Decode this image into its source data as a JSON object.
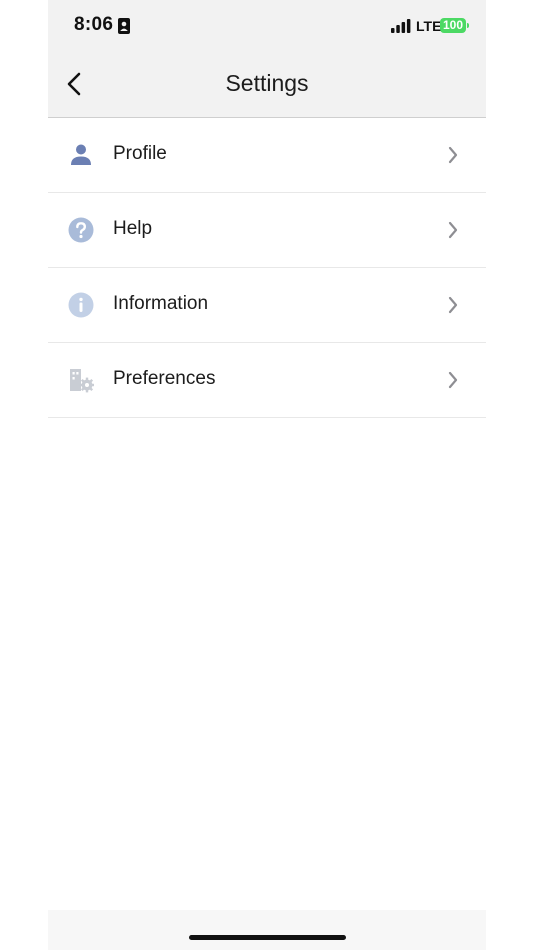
{
  "status_bar": {
    "time": "8:06",
    "network": "LTE",
    "battery_level": "100",
    "battery_color": "#4cd964"
  },
  "nav": {
    "title": "Settings",
    "back_icon": "chevron-left-icon"
  },
  "settings": {
    "items": [
      {
        "label": "Profile",
        "icon": "person-icon",
        "icon_color": "#6b7fb3"
      },
      {
        "label": "Help",
        "icon": "question-circle-icon",
        "icon_color": "#a9bbd9"
      },
      {
        "label": "Information",
        "icon": "info-circle-icon",
        "icon_color": "#c2d0e6"
      },
      {
        "label": "Preferences",
        "icon": "building-gear-icon",
        "icon_color": "#c9cdd4"
      }
    ],
    "chevron_icon": "chevron-right-icon"
  },
  "colors": {
    "bar_background": "#f2f2f2",
    "text": "#1c1c1c",
    "chevron": "#8e8e93"
  }
}
